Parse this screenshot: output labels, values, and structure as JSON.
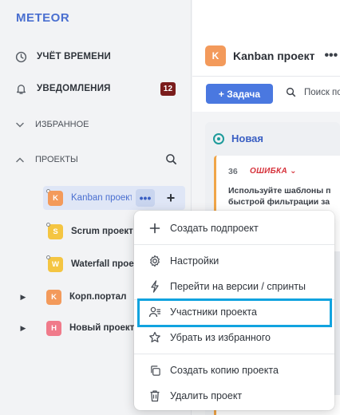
{
  "app": {
    "logo": "METEOR"
  },
  "sidebar": {
    "time_tracking": "УЧЁТ ВРЕМЕНИ",
    "notifications": "УВЕДОМЛЕНИЯ",
    "notifications_count": "12",
    "favorites": "ИЗБРАННОЕ",
    "projects": "ПРОЕКТЫ",
    "project_items": [
      {
        "letter": "K",
        "name": "Kanban проект",
        "color": "#f39a5b"
      },
      {
        "letter": "S",
        "name": "Scrum проект",
        "color": "#f4c542"
      },
      {
        "letter": "W",
        "name": "Waterfall проект",
        "color": "#f4c542"
      },
      {
        "letter": "K",
        "name": "Корп.портал",
        "color": "#f39a5b"
      },
      {
        "letter": "H",
        "name": "Новый проект",
        "color": "#f07a8a"
      }
    ]
  },
  "main": {
    "project_letter": "K",
    "project_title": "Kanban проект",
    "add_task_label": "+ Задача",
    "search_label": "Поиск по",
    "column_title": "Новая",
    "card": {
      "number": "36",
      "tag": "ОШИБКА",
      "text_line1": "Используйте шаблоны п",
      "text_line2": "быстрой фильтрации за"
    }
  },
  "context_menu": {
    "items": [
      "Создать подпроект",
      "Настройки",
      "Перейти на версии / спринты",
      "Участники проекта",
      "Убрать из избранного",
      "Создать копию проекта",
      "Удалить проект"
    ],
    "highlighted_item": "Участники проекта",
    "highlight_color": "#11a3df"
  }
}
